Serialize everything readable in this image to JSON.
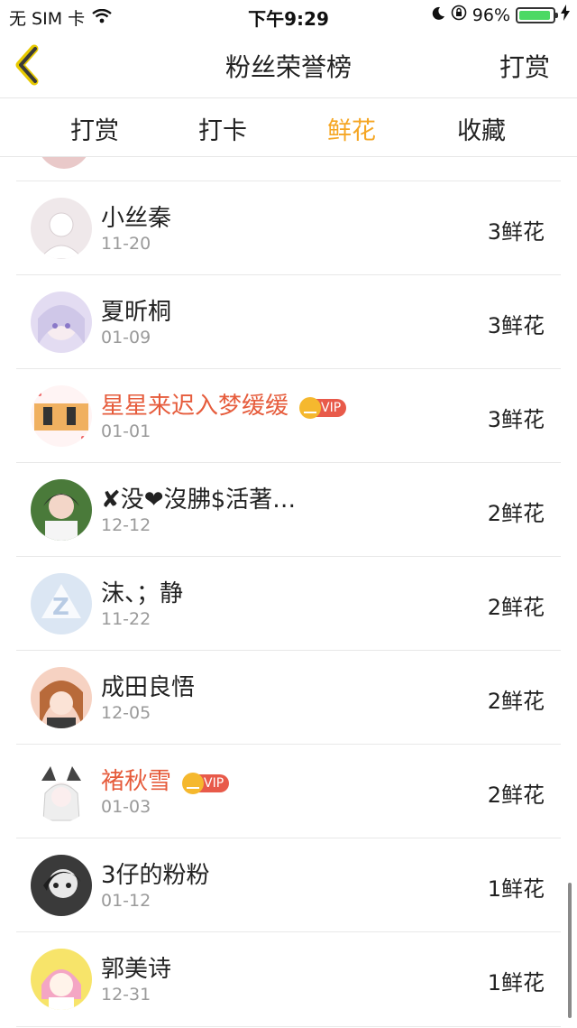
{
  "status_bar": {
    "carrier": "无 SIM 卡",
    "time": "下午9:29",
    "battery": "96%",
    "battery_level": 0.96
  },
  "nav": {
    "title": "粉丝荣誉榜",
    "right_label": "打赏",
    "back_icon": "chevron-left-icon"
  },
  "tabs": [
    {
      "label": "打赏",
      "active": false
    },
    {
      "label": "打卡",
      "active": false
    },
    {
      "label": "鲜花",
      "active": true
    },
    {
      "label": "收藏",
      "active": false
    }
  ],
  "vip_label": "VIP",
  "colors": {
    "accent": "#f5a623",
    "vip_name": "#e65c3c",
    "vip_badge": "#e85a4a",
    "date": "#9a9a9a"
  },
  "fans": [
    {
      "name": "小丝秦",
      "date": "11-20",
      "count": "3鲜花",
      "vip": false
    },
    {
      "name": "夏昕桐",
      "date": "01-09",
      "count": "3鲜花",
      "vip": false
    },
    {
      "name": "星星来迟入梦缓缓",
      "date": "01-01",
      "count": "3鲜花",
      "vip": true
    },
    {
      "name": "✘没❤沒胇$活著…",
      "date": "12-12",
      "count": "2鲜花",
      "vip": false
    },
    {
      "name": "沫、；静",
      "date": "11-22",
      "count": "2鲜花",
      "vip": false
    },
    {
      "name": "成田良悟",
      "date": "12-05",
      "count": "2鲜花",
      "vip": false
    },
    {
      "name": "褚秋雪",
      "date": "01-03",
      "count": "2鲜花",
      "vip": true
    },
    {
      "name": "3仔的粉粉",
      "date": "01-12",
      "count": "1鲜花",
      "vip": false
    },
    {
      "name": "郭美诗",
      "date": "12-31",
      "count": "1鲜花",
      "vip": false
    }
  ]
}
